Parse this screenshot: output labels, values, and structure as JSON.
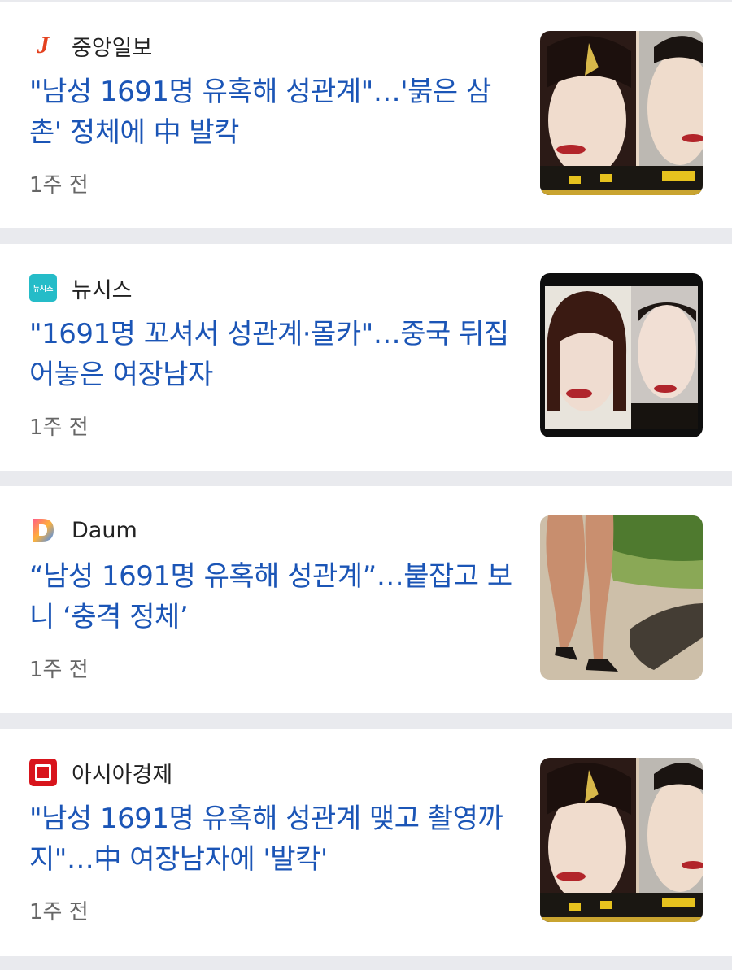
{
  "articles": [
    {
      "source": "중앙일보",
      "logo_icon": "joongang-logo-icon",
      "logo_text": "J",
      "headline": "\"남성 1691명 유혹해 성관계\"…'붉은 삼촌' 정체에 中 발칵",
      "time": "1주 전"
    },
    {
      "source": "뉴시스",
      "logo_icon": "newsis-logo-icon",
      "logo_text": "뉴시스",
      "headline": "\"1691명 꼬셔서 성관계·몰카\"…중국 뒤집어놓은 여장남자",
      "time": "1주 전"
    },
    {
      "source": "Daum",
      "logo_icon": "daum-logo-icon",
      "headline": "“남성 1691명 유혹해 성관계”…붙잡고 보니 ‘충격 정체’",
      "time": "1주 전"
    },
    {
      "source": "아시아경제",
      "logo_icon": "asiae-logo-icon",
      "headline": "\"남성 1691명 유혹해 성관계 맺고 촬영까지\"…中 여장남자에 '발칵'",
      "time": "1주 전"
    }
  ],
  "colors": {
    "headline": "#1b55b6",
    "background": "#e9eaee",
    "card": "#ffffff"
  }
}
